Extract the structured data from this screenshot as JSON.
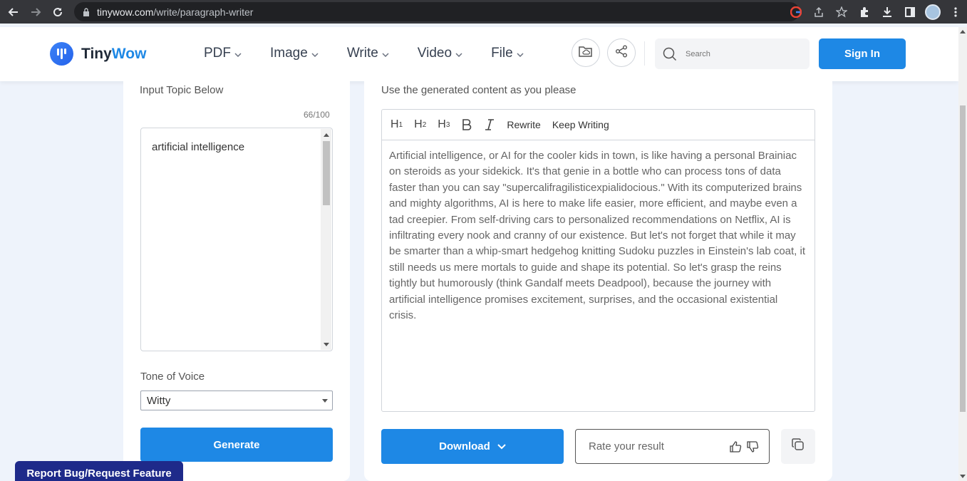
{
  "browser": {
    "url_host": "tinywow.com",
    "url_path": "/write/paragraph-writer"
  },
  "header": {
    "logo_tiny": "Tiny",
    "logo_wow": "Wow",
    "nav": [
      {
        "label": "PDF"
      },
      {
        "label": "Image"
      },
      {
        "label": "Write"
      },
      {
        "label": "Video"
      },
      {
        "label": "File"
      }
    ],
    "search_placeholder": "Search",
    "signin_label": "Sign In"
  },
  "left": {
    "input_label": "Input Topic Below",
    "counter": "66/100",
    "topic_value": "artificial intelligence",
    "tone_label": "Tone of Voice",
    "tone_value": "Witty",
    "generate_label": "Generate"
  },
  "right": {
    "hint": "Use the generated content as you please",
    "toolbar": {
      "rewrite": "Rewrite",
      "keep_writing": "Keep Writing"
    },
    "content": "Artificial intelligence, or AI for the cooler kids in town, is like having a personal Brainiac on steroids as your sidekick. It's that genie in a bottle who can process tons of data faster than you can say \"supercalifragilisticexpialidocious.\" With its computerized brains and mighty algorithms, AI is here to make life easier, more efficient, and maybe even a tad creepier. From self-driving cars to personalized recommendations on Netflix, AI is infiltrating every nook and cranny of our existence. But let's not forget that while it may be smarter than a whip-smart hedgehog knitting Sudoku puzzles in Einstein's lab coat, it still needs us mere mortals to guide and shape its potential. So let's grasp the reins tightly but humorously (think Gandalf meets Deadpool), because the journey with artificial intelligence promises excitement, surprises, and the occasional existential crisis.",
    "download_label": "Download",
    "rate_label": "Rate your result"
  },
  "report_label": "Report Bug/Request Feature",
  "colors": {
    "accent": "#1e88e5",
    "report": "#1e2a8a"
  }
}
